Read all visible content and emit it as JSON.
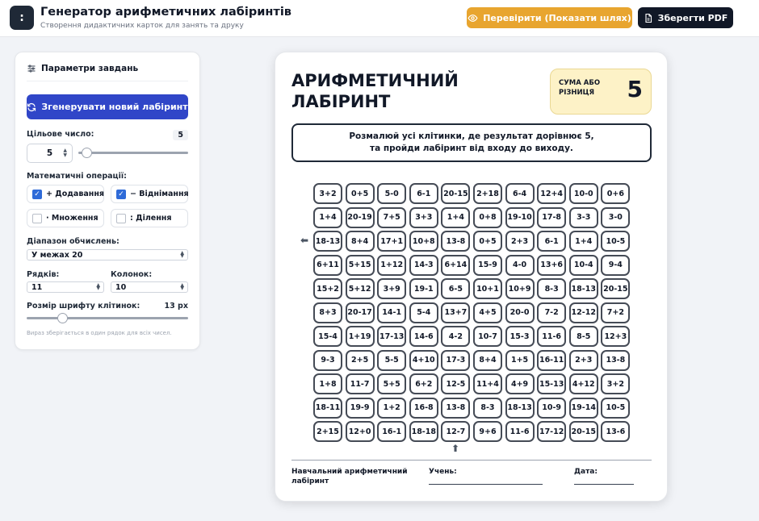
{
  "header": {
    "icon_glyph": ":",
    "title": "Генератор арифметичних лабіринтів",
    "subtitle": "Створення дидактичних карток для занять та друку",
    "check_label": "Перевірити (Показати шлях)",
    "save_label": "Зберегти PDF"
  },
  "sidebar": {
    "title": "Параметри завдань",
    "generate_label": "Згенерувати новий лабіринт",
    "target_label": "Цільове число:",
    "target_value": "5",
    "target_input": "5",
    "target_level": 0.07,
    "ops_label": "Математичні операції:",
    "ops": [
      {
        "label": "+ Додавання",
        "checked": true
      },
      {
        "label": "− Віднімання",
        "checked": true
      },
      {
        "label": "· Множення",
        "checked": false
      },
      {
        "label": ": Ділення",
        "checked": false
      }
    ],
    "range_label": "Діапазон обчислень:",
    "range_value": "У межах 20",
    "rows_label": "Рядків:",
    "rows_value": "11",
    "cols_label": "Колонок:",
    "cols_value": "10",
    "font_label": "Розмір шрифту клітинок:",
    "font_value": "13 px",
    "font_level": 0.22,
    "hint": "Вираз зберігається в один рядок для всіх чисел."
  },
  "card": {
    "title": "АРИФМЕТИЧНИЙ ЛАБІРИНТ",
    "badge_label": "СУМА АБО РІЗНИЦЯ",
    "badge_value": "5",
    "instruction_1": "Розмалюй усі клітинки, де результат дорівнює 5,",
    "instruction_2": "та пройди лабіринт від входу до виходу.",
    "footer_title": "Навчальний арифметичний лабіринт",
    "student_label": "Учень:",
    "date_label": "Дата:",
    "grid": [
      [
        "3+2",
        "0+5",
        "5-0",
        "6-1",
        "20-15",
        "2+18",
        "6-4",
        "12+4",
        "10-0",
        "0+6"
      ],
      [
        "1+4",
        "20-19",
        "7+5",
        "3+3",
        "1+4",
        "0+8",
        "19-10",
        "17-8",
        "3-3",
        "3-0"
      ],
      [
        "18-13",
        "8+4",
        "17+1",
        "10+8",
        "13-8",
        "0+5",
        "2+3",
        "6-1",
        "1+4",
        "10-5"
      ],
      [
        "6+11",
        "5+15",
        "1+12",
        "14-3",
        "6+14",
        "15-9",
        "4-0",
        "13+6",
        "10-4",
        "9-4"
      ],
      [
        "15+2",
        "5+12",
        "3+9",
        "19-1",
        "6-5",
        "10+1",
        "10+9",
        "8-3",
        "18-13",
        "20-15"
      ],
      [
        "8+3",
        "20-17",
        "14-1",
        "5-4",
        "13+7",
        "4+5",
        "20-0",
        "7-2",
        "12-12",
        "7+2"
      ],
      [
        "15-4",
        "1+19",
        "17-13",
        "14-6",
        "4-2",
        "10-7",
        "15-3",
        "11-6",
        "8-5",
        "12+3"
      ],
      [
        "9-3",
        "2+5",
        "5-5",
        "4+10",
        "17-3",
        "8+4",
        "1+5",
        "16-11",
        "2+3",
        "13-8"
      ],
      [
        "1+8",
        "11-7",
        "5+5",
        "6+2",
        "12-5",
        "11+4",
        "4+9",
        "15-13",
        "4+12",
        "3+2"
      ],
      [
        "18-11",
        "19-9",
        "1+2",
        "16-8",
        "13-8",
        "8-3",
        "18-13",
        "10-9",
        "19-14",
        "10-5"
      ],
      [
        "2+15",
        "12+0",
        "16-1",
        "18-18",
        "12-7",
        "9+6",
        "11-6",
        "17-12",
        "20-15",
        "13-6"
      ]
    ]
  }
}
